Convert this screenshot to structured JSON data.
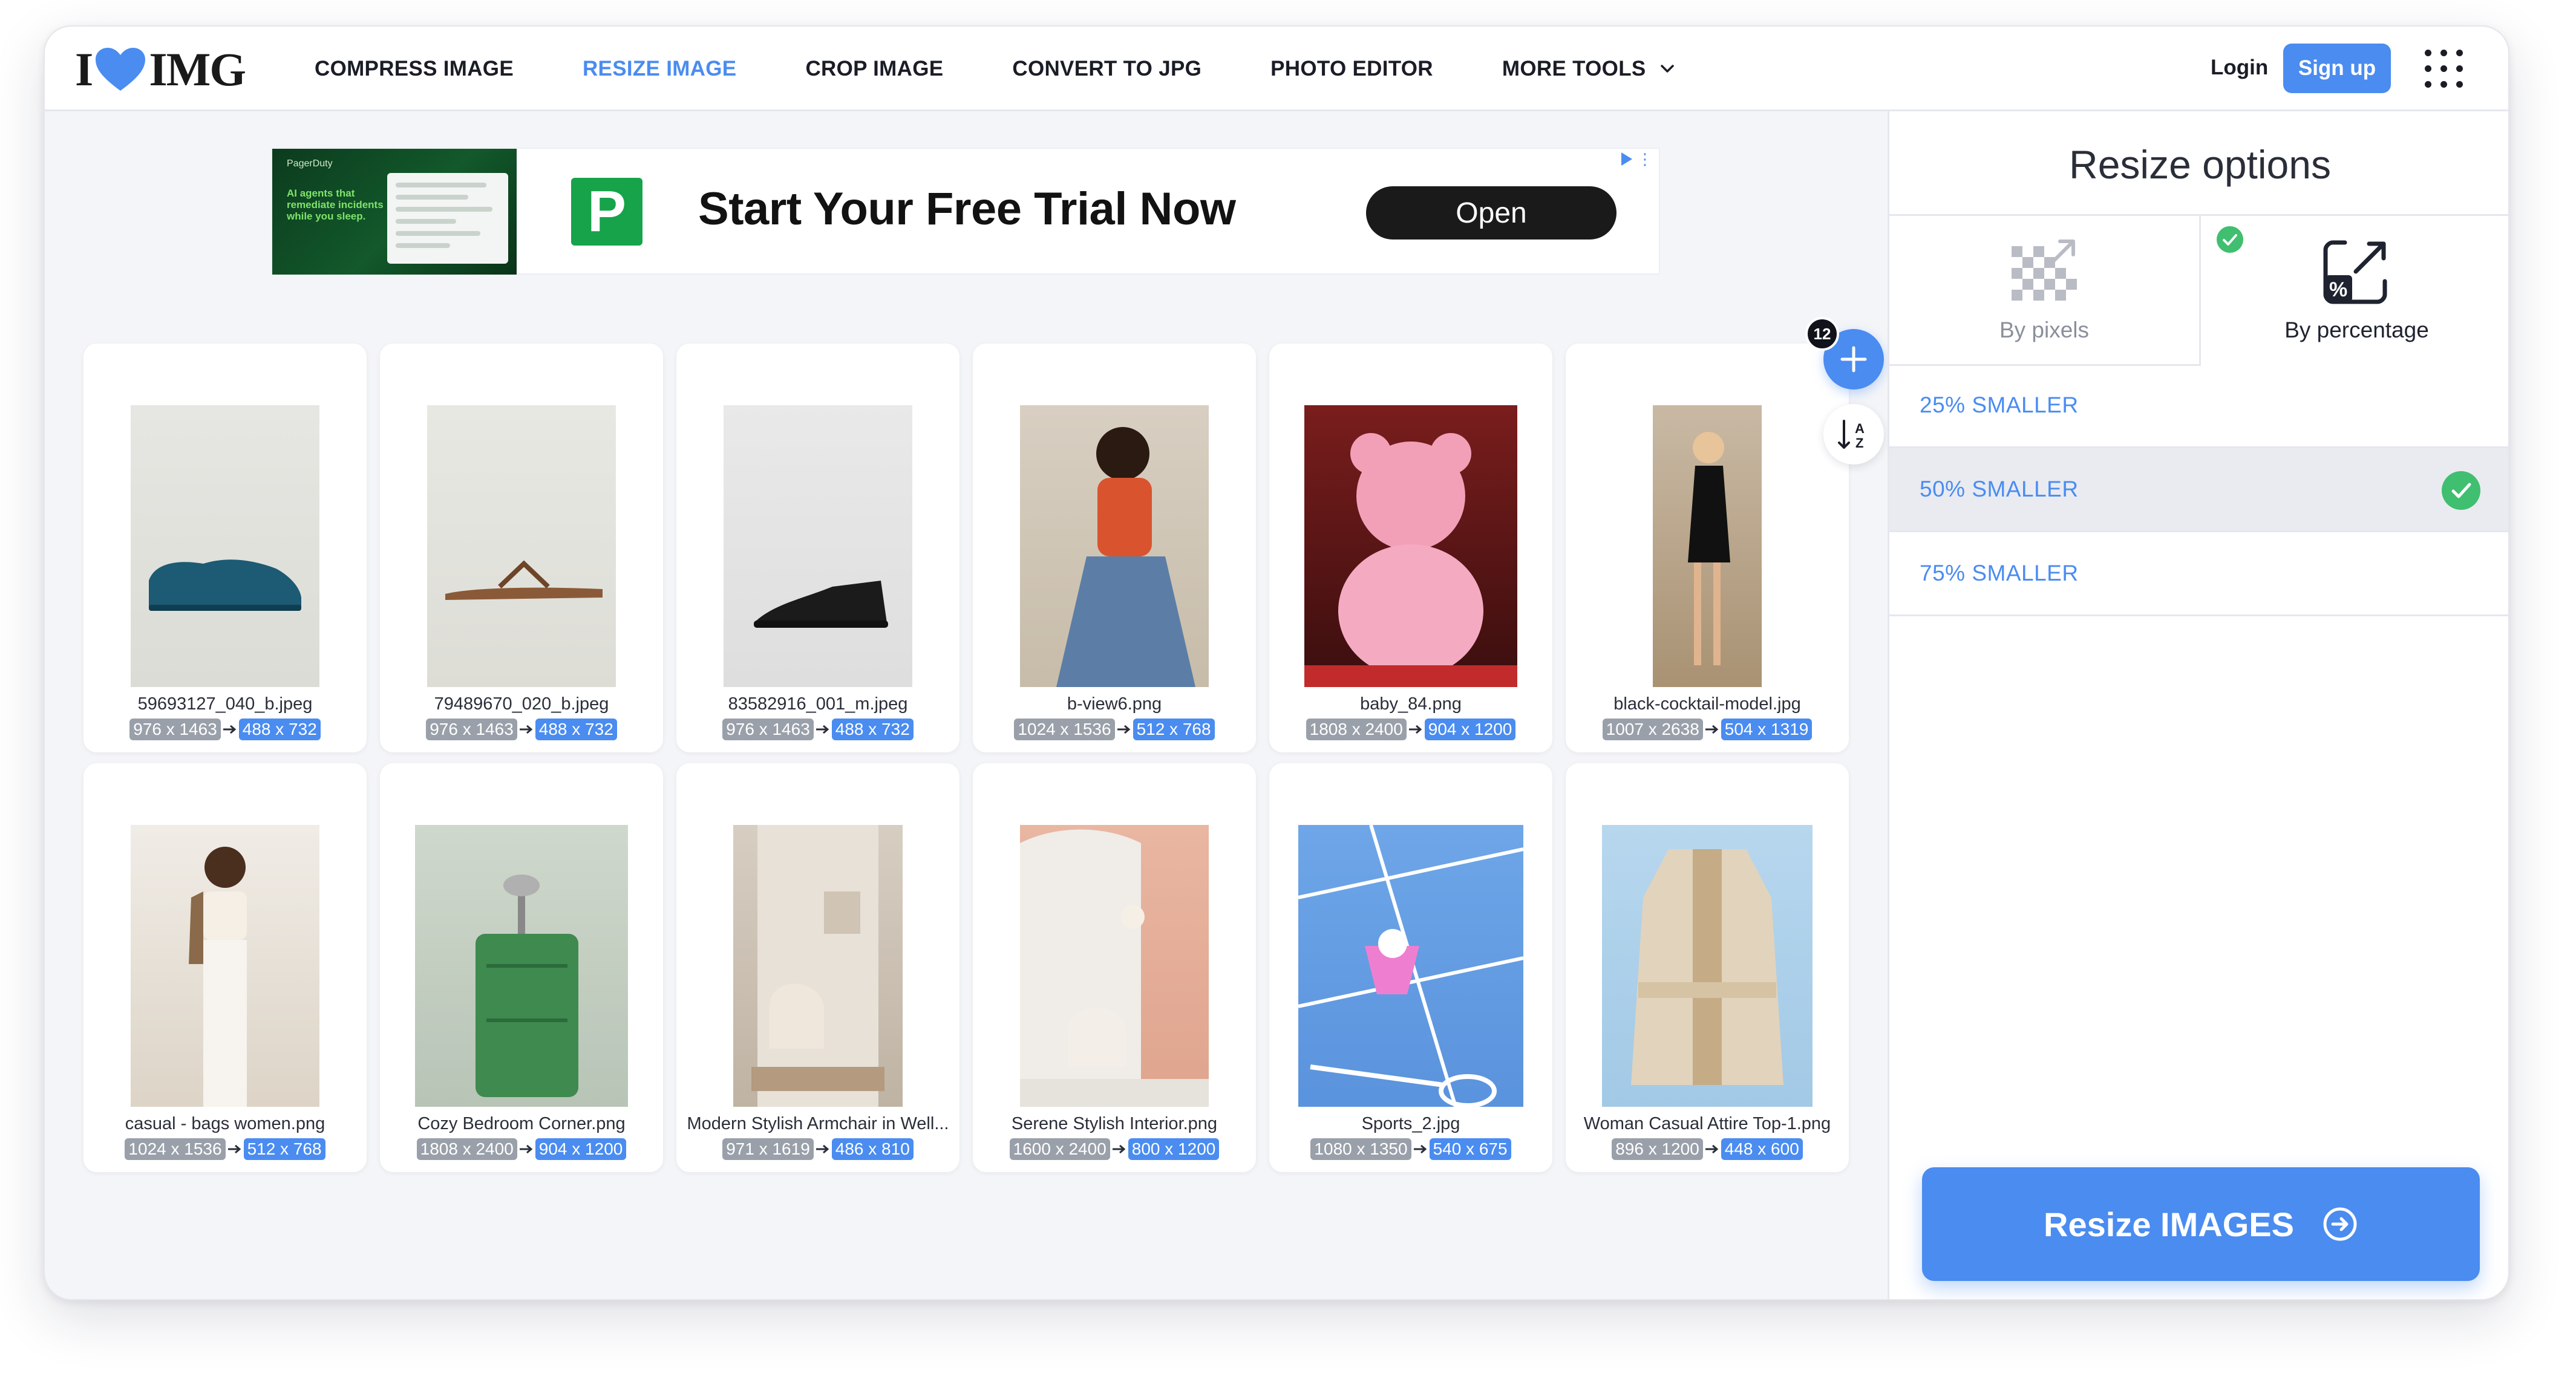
{
  "header": {
    "logo": "IMG",
    "nav": [
      {
        "label": "COMPRESS IMAGE",
        "active": false
      },
      {
        "label": "RESIZE IMAGE",
        "active": true
      },
      {
        "label": "CROP IMAGE",
        "active": false
      },
      {
        "label": "CONVERT TO JPG",
        "active": false
      },
      {
        "label": "PHOTO EDITOR",
        "active": false
      },
      {
        "label": "MORE TOOLS",
        "active": false,
        "icon": "chevron-down-icon"
      }
    ],
    "login": "Login",
    "signup": "Sign up",
    "apps_icon": "grid-icon"
  },
  "ad": {
    "thumb_brand": "PagerDuty",
    "thumb_copy": "AI agents that remediate incidents while you sleep.",
    "logo_letter": "P",
    "headline": "Start Your Free Trial Now",
    "cta": "Open"
  },
  "upload": {
    "count": "12",
    "add_icon": "plus-icon",
    "sort_icon": "sort-az-icon"
  },
  "images": [
    {
      "name": "59693127_040_b.jpeg",
      "original": "976 x 1463",
      "resized": "488 x 732"
    },
    {
      "name": "79489670_020_b.jpeg",
      "original": "976 x 1463",
      "resized": "488 x 732"
    },
    {
      "name": "83582916_001_m.jpeg",
      "original": "976 x 1463",
      "resized": "488 x 732"
    },
    {
      "name": "b-view6.png",
      "original": "1024 x 1536",
      "resized": "512 x 768"
    },
    {
      "name": "baby_84.png",
      "original": "1808 x 2400",
      "resized": "904 x 1200"
    },
    {
      "name": "black-cocktail-model.jpg",
      "original": "1007 x 2638",
      "resized": "504 x 1319"
    },
    {
      "name": "casual - bags women.png",
      "original": "1024 x 1536",
      "resized": "512 x 768"
    },
    {
      "name": "Cozy Bedroom Corner.png",
      "original": "1808 x 2400",
      "resized": "904 x 1200"
    },
    {
      "name": "Modern Stylish Armchair in Well...",
      "original": "971 x 1619",
      "resized": "486 x 810"
    },
    {
      "name": "Serene Stylish Interior.png",
      "original": "1600 x 2400",
      "resized": "800 x 1200"
    },
    {
      "name": "Sports_2.jpg",
      "original": "1080 x 1350",
      "resized": "540 x 675"
    },
    {
      "name": "Woman Casual Attire Top-1.png",
      "original": "896 x 1200",
      "resized": "448 x 600"
    }
  ],
  "panel": {
    "title": "Resize options",
    "modes": [
      {
        "label": "By pixels",
        "selected": false
      },
      {
        "label": "By percentage",
        "selected": true
      }
    ],
    "options": [
      {
        "label": "25% SMALLER",
        "selected": false
      },
      {
        "label": "50% SMALLER",
        "selected": true
      },
      {
        "label": "75% SMALLER",
        "selected": false
      }
    ],
    "submit": "Resize IMAGES"
  },
  "colors": {
    "accent": "#4a8cf0",
    "success": "#3fbf6f",
    "text": "#1f2330"
  }
}
